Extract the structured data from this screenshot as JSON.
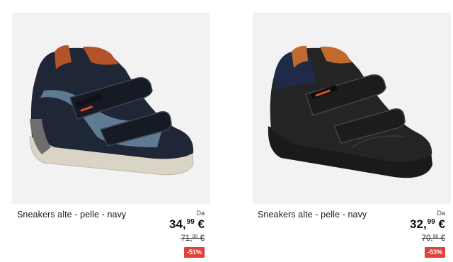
{
  "products": [
    {
      "title": "Sneakers alte - pelle - navy",
      "from_label": "Da",
      "price_int": "34",
      "price_dec": "99",
      "currency": "€",
      "old_price_int": "71",
      "old_price_dec": "90",
      "discount": "-51%",
      "shoe_icon": "sneaker-navy-image"
    },
    {
      "title": "Sneakers alte - pelle - navy",
      "from_label": "Da",
      "price_int": "32",
      "price_dec": "99",
      "currency": "€",
      "old_price_int": "70",
      "old_price_dec": "90",
      "discount": "-53%",
      "shoe_icon": "sneaker-black-image"
    }
  ],
  "colors": {
    "card_bg": "#f2f2f2",
    "discount_badge": "#e0413b"
  }
}
